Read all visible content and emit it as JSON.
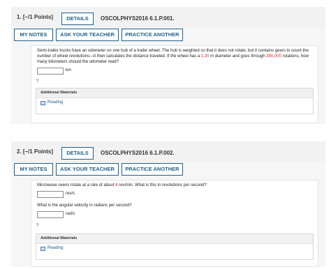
{
  "questions": [
    {
      "number_label": "1. [–/1 Points]",
      "details_label": "DETAILS",
      "code": "OSCOLPHYS2016 6.1.P.001.",
      "my_notes_label": "MY NOTES",
      "ask_teacher_label": "ASK YOUR TEACHER",
      "practice_label": "PRACTICE ANOTHER",
      "text_parts": {
        "a": "Semi-trailer trucks have an odometer on one hub of a trailer wheel. The hub is weighted so that it does not rotate, but it contains gears to count the number of wheel revolutions—it then calculates the distance traveled. If the wheel has a ",
        "diameter_value": "1.20",
        "b": " m diameter and goes through ",
        "rotations_value": "280,000",
        "c": " rotations, how many kilometers should the odometer read?"
      },
      "answer_unit": "km",
      "answer_value": "",
      "question_mark": "?",
      "additional_materials_label": "Additional Materials",
      "reading_label": "Reading"
    },
    {
      "number_label": "2. [–/1 Points]",
      "details_label": "DETAILS",
      "code": "OSCOLPHYS2016 6.1.P.002.",
      "my_notes_label": "MY NOTES",
      "ask_teacher_label": "ASK YOUR TEACHER",
      "practice_label": "PRACTICE ANOTHER",
      "text_parts": {
        "a": "Microwave ovens rotate at a rate of about ",
        "rate_value": "8",
        "b": " rev/min. What is this in revolutions per second?"
      },
      "answer_unit": "rev/s",
      "answer_value": "",
      "second_prompt": "What is the angular velocity in radians per second?",
      "second_unit": "rad/s",
      "second_value": "",
      "question_mark": "?",
      "additional_materials_label": "Additional Materials",
      "reading_label": "Reading"
    }
  ],
  "colors": {
    "accent": "#1f5f8b",
    "highlight_red": "#d9231d"
  },
  "icons": {
    "reading": "book-icon"
  }
}
